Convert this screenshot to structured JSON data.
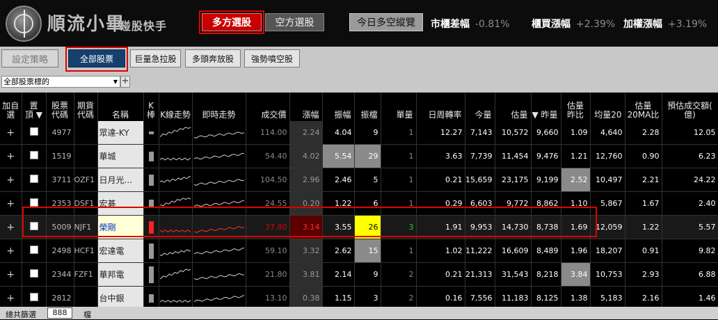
{
  "app": {
    "brand": "順流小畢",
    "brand_sub": "碰股快手"
  },
  "header": {
    "long_btn": "多方選股",
    "short_btn": "空方選股",
    "today_btn": "今日多空縱覽",
    "stats": [
      {
        "label": "市櫃差幅",
        "value": "-0.81%"
      },
      {
        "label": "櫃買漲幅",
        "value": "+2.39%"
      },
      {
        "label": "加權漲幅",
        "value": "+3.19%"
      }
    ]
  },
  "toolbar": {
    "strategy": "設定策略",
    "all_stocks": "全部股票",
    "surge": "巨量急拉股",
    "bull": "多頭奔放股",
    "bear": "強勢噴空股",
    "selector_value": "全部股票標的",
    "plus": "+"
  },
  "columns": {
    "add": [
      "加自",
      "選"
    ],
    "pin": [
      "置",
      "頂 ▼"
    ],
    "code": [
      "股票",
      "代碼"
    ],
    "fut": [
      "期貨",
      "代碼"
    ],
    "name": "名稱",
    "k": [
      "K",
      "棒"
    ],
    "kline": "K線走勢",
    "intraday": "即時走勢",
    "price": "成交價",
    "chg": "漲幅",
    "amp1": "振幅",
    "amp2": "振檔",
    "vol_unit": "單量",
    "turnover": "日周轉率",
    "today_vol": "今量",
    "est_vol": "估量",
    "prev_vol": "▼ 昨量",
    "est_ratio": [
      "估量",
      "昨比"
    ],
    "avg20": "均量20",
    "est20": [
      "估量",
      "20MA比"
    ],
    "est_amount": [
      "預估成交額(",
      "億)"
    ]
  },
  "rows": [
    {
      "plus": "+",
      "code": "4977",
      "fut": "",
      "name": "眾達-KY",
      "price": "114.00",
      "chg": "2.24",
      "amp1": "4.04",
      "amp2": "9",
      "unit": "1",
      "turn": "12.27",
      "vol": "7,143",
      "est": "10,572",
      "prev": "9,660",
      "ratio": "1.09",
      "avg20": "4,640",
      "ma20": "2.28",
      "amount": "12.05"
    },
    {
      "plus": "+",
      "code": "1519",
      "fut": "",
      "name": "華城",
      "price": "54.40",
      "chg": "4.02",
      "amp1": "5.54",
      "amp2": "29",
      "unit": "1",
      "turn": "3.63",
      "vol": "7,739",
      "est": "11,454",
      "prev": "9,476",
      "ratio": "1.21",
      "avg20": "12,760",
      "ma20": "0.90",
      "amount": "6.23"
    },
    {
      "plus": "+",
      "code": "3711",
      "fut": "OZF1",
      "name": "日月光...",
      "price": "104.50",
      "chg": "2.96",
      "amp1": "2.46",
      "amp2": "5",
      "unit": "1",
      "turn": "0.21",
      "vol": "15,659",
      "est": "23,175",
      "prev": "9,199",
      "ratio": "2.52",
      "avg20": "10,497",
      "ma20": "2.21",
      "amount": "24.22"
    },
    {
      "plus": "+",
      "code": "2353",
      "fut": "DSF1",
      "name": "宏碁",
      "price": "24.55",
      "chg": "0.20",
      "amp1": "1.22",
      "amp2": "6",
      "unit": "1",
      "turn": "0.29",
      "vol": "6,603",
      "est": "9,772",
      "prev": "8,862",
      "ratio": "1.10",
      "avg20": "5,867",
      "ma20": "1.67",
      "amount": "2.40"
    },
    {
      "plus": "+",
      "code": "5009",
      "fut": "NJF1",
      "name": "榮剛",
      "price": "37.80",
      "chg": "3.14",
      "amp1": "3.55",
      "amp2": "26",
      "unit": "3",
      "turn": "1.91",
      "vol": "9,953",
      "est": "14,730",
      "prev": "8,738",
      "ratio": "1.69",
      "avg20": "12,059",
      "ma20": "1.22",
      "amount": "5.57"
    },
    {
      "plus": "+",
      "code": "2498",
      "fut": "HCF1",
      "name": "宏達電",
      "price": "59.10",
      "chg": "3.32",
      "amp1": "2.62",
      "amp2": "15",
      "unit": "1",
      "turn": "1.02",
      "vol": "11,222",
      "est": "16,609",
      "prev": "8,489",
      "ratio": "1.96",
      "avg20": "18,207",
      "ma20": "0.91",
      "amount": "9.82"
    },
    {
      "plus": "+",
      "code": "2344",
      "fut": "FZF1",
      "name": "華邦電",
      "price": "21.80",
      "chg": "3.81",
      "amp1": "2.14",
      "amp2": "9",
      "unit": "2",
      "turn": "0.21",
      "vol": "21,313",
      "est": "31,543",
      "prev": "8,218",
      "ratio": "3.84",
      "avg20": "10,753",
      "ma20": "2.93",
      "amount": "6.88"
    },
    {
      "plus": "+",
      "code": "2812",
      "fut": "",
      "name": "台中銀",
      "price": "13.10",
      "chg": "0.38",
      "amp1": "1.15",
      "amp2": "3",
      "unit": "2",
      "turn": "0.16",
      "vol": "7,556",
      "est": "11,183",
      "prev": "8,125",
      "ratio": "1.38",
      "avg20": "5,183",
      "ma20": "2.16",
      "amount": "1.46"
    }
  ],
  "footer": {
    "label": "總共篩選",
    "count": "888",
    "unit": "檔"
  },
  "colors": {
    "long_accent": "#c80000",
    "selected_tab": "#15406e",
    "highlight": "#ffff00",
    "down": "#22cc22"
  }
}
